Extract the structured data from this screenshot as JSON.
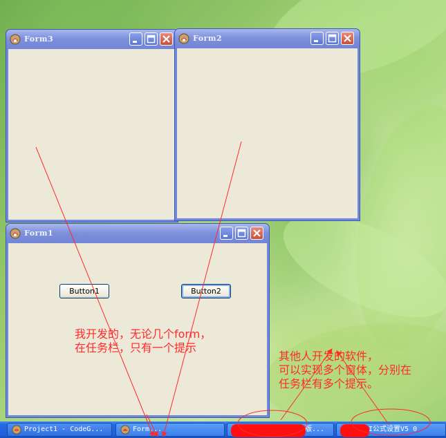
{
  "windows": {
    "form3": {
      "title": "Form3"
    },
    "form2": {
      "title": "Form2"
    },
    "form1": {
      "title": "Form1",
      "button1_label": "Button1",
      "button2_label": "Button2"
    }
  },
  "taskbar": {
    "items": [
      {
        "label": "Project1 - CodeG..."
      },
      {
        "label": "Form..."
      },
      {
        "label": "版..."
      },
      {
        "label": "I公式设置V5 0"
      }
    ]
  },
  "annotations": {
    "left_line1": "我开发的，无论几个form，",
    "left_line2": "在任务栏，只有一个提示",
    "right_line1": "其他人开发的软件，",
    "right_line2": "可以实现多个窗体，分别在",
    "right_line3": "任务栏有多个提示。"
  },
  "colors": {
    "annotation_red": "#ff2a2a",
    "titlebar_blue": "#7e91dc",
    "taskbar_blue": "#2468e2",
    "window_face": "#ece9d8"
  },
  "icons": {
    "window_app": "app-icon",
    "minimize": "minimize-icon",
    "maximize": "maximize-icon",
    "close": "close-icon"
  }
}
